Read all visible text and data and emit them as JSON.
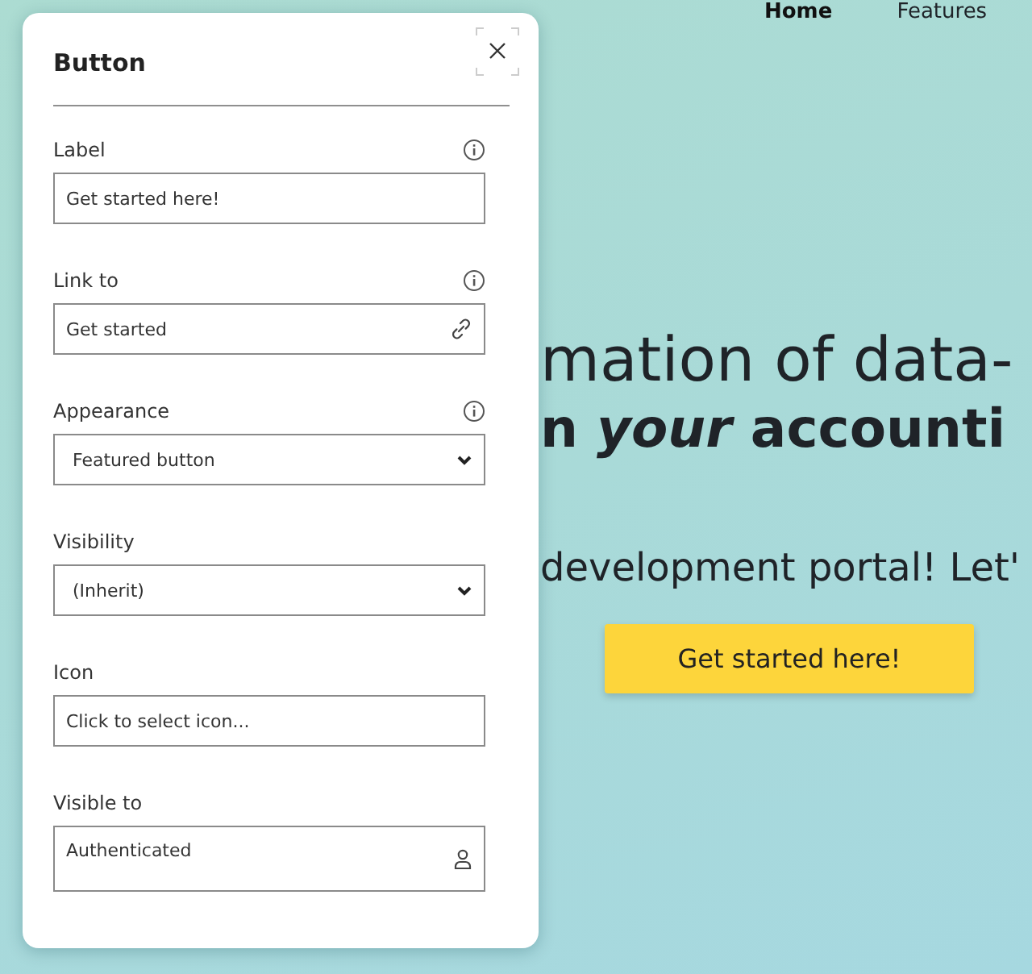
{
  "nav": [
    {
      "label": "Home",
      "selected": true
    },
    {
      "label": "Features",
      "selected": false
    }
  ],
  "hero": {
    "headline_1_right": "mation of data-",
    "headline_2_right": "n *your* accounti",
    "subtitle_right": "development portal! Let'"
  },
  "cta_button": "Get started here!",
  "panel": {
    "title": "Button",
    "fields": [
      {
        "label": "Label",
        "kind": "text",
        "value": "Get started here!",
        "info": true
      },
      {
        "label": "Link to",
        "kind": "link",
        "value": "Get started",
        "info": true
      },
      {
        "label": "Appearance",
        "kind": "select",
        "value": "Featured button",
        "info": true
      },
      {
        "label": "Visibility",
        "kind": "select",
        "value": "(Inherit)",
        "info": false
      },
      {
        "label": "Icon",
        "kind": "text",
        "value": "Click to select icon...",
        "info": false
      },
      {
        "label": "Visible to",
        "kind": "user",
        "value": "Authenticated",
        "info": false
      }
    ]
  }
}
